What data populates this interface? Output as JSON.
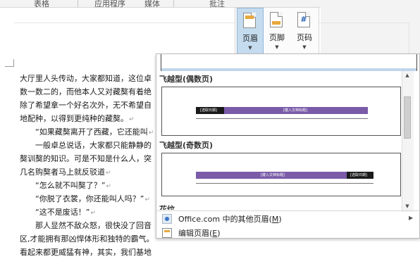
{
  "ribbon": {
    "top_labels": [
      "表格",
      "应用程序",
      "媒体",
      "批注"
    ]
  },
  "header_footer_group": {
    "buttons": [
      {
        "label": "页眉",
        "icon": "header-icon"
      },
      {
        "label": "页脚",
        "icon": "footer-icon"
      },
      {
        "label": "页码",
        "icon": "page-number-icon",
        "glyph": "#"
      }
    ],
    "caret": "▼"
  },
  "document": {
    "lines": [
      "大厅里人头传动，大家都知道，这位卓",
      "数一数二的，而他本人又对藏獒有着绝",
      "除了希望拿一个好名次外，无不希望自",
      "地配种，以得到更纯种的藏獒。",
      "“如果藏獒离开了西藏，它还能叫",
      "一般卓总说话，大家都只能静静的",
      "獒训獒的知识。可是不知是什么人，突",
      "几名购獒者马上就反驳道",
      "“怎么就不叫獒了？”",
      "“你脱了衣裳，你还能叫人吗？”",
      "“这不是废话！”",
      "那人显然不敌众怒，很快没了回音",
      "区,才能拥有那凶悍体形和独特的霸气。",
      "看起来都更威猛有神，其实，我们基地"
    ],
    "indented_lines": [
      4,
      5,
      8,
      9,
      10,
      11
    ],
    "paragraph_end_lines": [
      3,
      4,
      7,
      8,
      9,
      10
    ],
    "paragraph_mark": "↵"
  },
  "gallery": {
    "sections": [
      {
        "title": "飞越型(偶数页)",
        "band_color": "#7a5ba8",
        "dark_color": "#1a1a1a",
        "dark_text": "[选取日期]",
        "purple_text": "[键入文档标题]"
      },
      {
        "title": "飞越型(奇数页)",
        "band_color": "#7a5ba8",
        "dark_color": "#1a1a1a",
        "purple_text": "[键入文档标题]",
        "dark_text": "[选取日期]"
      }
    ],
    "next_section_partial": "花纹",
    "menu": [
      {
        "label": "Office.com 中的其他页眉(",
        "hotkey": "M",
        "suffix": ")",
        "icon": "office-icon",
        "has_submenu": true
      },
      {
        "label": "编辑页眉(",
        "hotkey": "E",
        "suffix": ")",
        "icon": "edit-header-icon",
        "has_submenu": false
      }
    ]
  }
}
